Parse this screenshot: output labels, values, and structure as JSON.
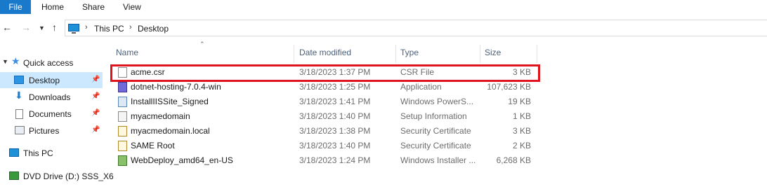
{
  "ribbon": {
    "tabs": [
      "File",
      "Home",
      "Share",
      "View"
    ]
  },
  "address": {
    "crumbs": [
      "This PC",
      "Desktop"
    ]
  },
  "nav": {
    "quick_access": "Quick access",
    "items": [
      {
        "label": "Desktop",
        "icon": "desktop-folder-icon"
      },
      {
        "label": "Downloads",
        "icon": "downloads-folder-icon"
      },
      {
        "label": "Documents",
        "icon": "documents-folder-icon"
      },
      {
        "label": "Pictures",
        "icon": "pictures-folder-icon"
      }
    ],
    "this_pc": "This PC",
    "dvd": "DVD Drive (D:) SSS_X6"
  },
  "columns": {
    "name": "Name",
    "date": "Date modified",
    "type": "Type",
    "size": "Size"
  },
  "files": [
    {
      "name": "acme.csr",
      "date": "3/18/2023 1:37 PM",
      "type": "CSR File",
      "size": "3 KB",
      "icon": "csr-file-icon"
    },
    {
      "name": "dotnet-hosting-7.0.4-win",
      "date": "3/18/2023 1:25 PM",
      "type": "Application",
      "size": "107,623 KB",
      "icon": "installer-app-icon"
    },
    {
      "name": "InstallIISSite_Signed",
      "date": "3/18/2023 1:41 PM",
      "type": "Windows PowerS...",
      "size": "19 KB",
      "icon": "powershell-script-icon"
    },
    {
      "name": "myacmedomain",
      "date": "3/18/2023 1:40 PM",
      "type": "Setup Information",
      "size": "1 KB",
      "icon": "setup-information-icon"
    },
    {
      "name": "myacmedomain.local",
      "date": "3/18/2023 1:38 PM",
      "type": "Security Certificate",
      "size": "3 KB",
      "icon": "certificate-icon"
    },
    {
      "name": "SAME Root",
      "date": "3/18/2023 1:40 PM",
      "type": "Security Certificate",
      "size": "2 KB",
      "icon": "certificate-icon"
    },
    {
      "name": "WebDeploy_amd64_en-US",
      "date": "3/18/2023 1:24 PM",
      "type": "Windows Installer ...",
      "size": "6,268 KB",
      "icon": "msi-installer-icon"
    }
  ],
  "highlight_color": "#e0141e",
  "accent": "#1979ca"
}
